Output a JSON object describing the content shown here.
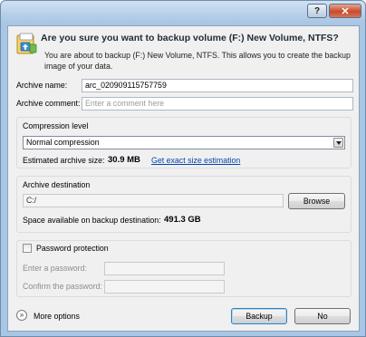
{
  "window": {
    "help_label": "?",
    "close_label": "✕"
  },
  "header": {
    "icon": "backup-volume-icon",
    "title": "Are you sure you want to backup volume (F:) New Volume, NTFS?",
    "description": "You are about to backup (F:) New Volume, NTFS. This allows you to create the backup image of your data."
  },
  "archive": {
    "name_label": "Archive name:",
    "name_value": "arc_020909115757759",
    "comment_label": "Archive comment:",
    "comment_placeholder": "Enter a comment here"
  },
  "compression": {
    "group_label": "Compression level",
    "selected": "Normal compression",
    "size_label": "Estimated archive size:",
    "size_value": "30.9 MB",
    "link_text": "Get exact size estimation"
  },
  "destination": {
    "group_label": "Archive destination",
    "path_value": "C:/",
    "browse_label": "Browse",
    "space_label": "Space available on backup destination:",
    "space_value": "491.3 GB"
  },
  "password": {
    "checkbox_label": "Password protection",
    "checked": false,
    "enter_label": "Enter a password:",
    "confirm_label": "Confirm the password:"
  },
  "footer": {
    "more_options_label": "More options",
    "more_icon": "double-chevron-down-icon",
    "backup_label": "Backup",
    "no_label": "No"
  },
  "colors": {
    "link": "#0645ad",
    "window_frame": "#a9c6e4",
    "close_button": "#c64b2c"
  }
}
